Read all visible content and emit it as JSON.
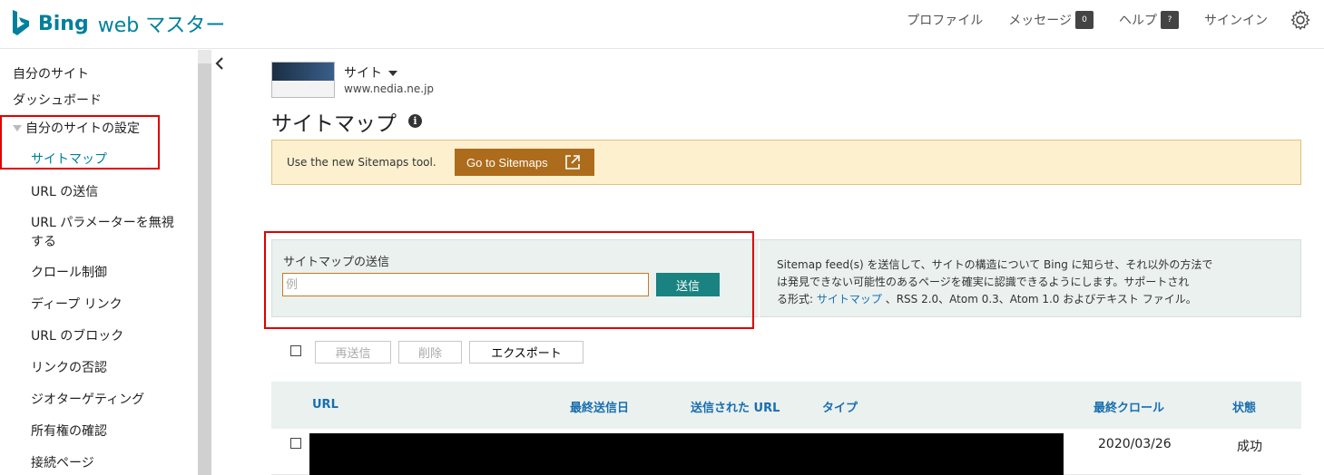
{
  "header": {
    "brand": "Bing",
    "product": "web マスター",
    "nav": {
      "profile": "プロファイル",
      "messages": "メッセージ",
      "messages_count": "0",
      "help": "ヘルプ",
      "help_badge": "?",
      "signin": "サインイン"
    },
    "icons": {
      "settings": "gear-icon"
    }
  },
  "sidebar": {
    "items": [
      {
        "label": "自分のサイト"
      },
      {
        "label": "ダッシュボード"
      },
      {
        "label": "自分のサイトの設定"
      },
      {
        "label": "サイトマップ"
      },
      {
        "label": "URL の送信"
      },
      {
        "label": "URL パラメーターを無視"
      },
      {
        "label": "する"
      },
      {
        "label": "クロール制御"
      },
      {
        "label": "ディープ リンク"
      },
      {
        "label": "URL のブロック"
      },
      {
        "label": "リンクの否認"
      },
      {
        "label": "ジオターゲティング"
      },
      {
        "label": "所有権の確認"
      },
      {
        "label": "接続ページ"
      }
    ]
  },
  "site": {
    "label": "サイト",
    "url": "www.nedia.ne.jp"
  },
  "page": {
    "title": "サイトマップ",
    "info_icon": "i"
  },
  "notice": {
    "text": "Use the new Sitemaps tool.",
    "button": "Go to Sitemaps"
  },
  "submit": {
    "label": "サイトマップの送信",
    "placeholder": "例",
    "button": "送信",
    "desc_1": "Sitemap feed(s) を送信して、サイトの構造について Bing に知らせ、それ以外の方法で",
    "desc_2": "は発見できない可能性のあるページを確実に認識できるようにします。サポートされ",
    "desc_3_prefix": "る形式: ",
    "desc_3_link": "サイトマップ",
    "desc_3_suffix": " 、RSS 2.0、Atom 0.3、Atom 1.0 およびテキスト ファイル。"
  },
  "toolbar": {
    "resend": "再送信",
    "delete": "削除",
    "export": "エクスポート"
  },
  "table": {
    "columns": [
      "URL",
      "最終送信日",
      "送信された URL",
      "タイプ",
      "最終クロール",
      "状態"
    ],
    "rows": [
      {
        "last_crawl": "2020/03/26",
        "status": "成功"
      }
    ]
  },
  "colors": {
    "brand": "#00809d",
    "notice_button": "#ad6c1c",
    "submit_button": "#1a8280",
    "highlight": "#e00000"
  }
}
